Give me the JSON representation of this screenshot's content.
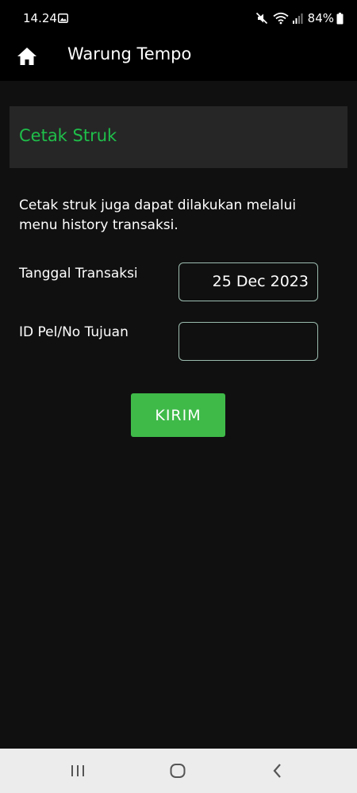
{
  "status_bar": {
    "time": "14.24",
    "battery": "84%"
  },
  "app_bar": {
    "title": "Warung Tempo"
  },
  "section": {
    "title": "Cetak Struk"
  },
  "info_text": "Cetak struk juga dapat dilakukan melalui menu history transaksi.",
  "form": {
    "date_label": "Tanggal Transaksi",
    "date_value": "25 Dec 2023",
    "id_label": "ID Pel/No Tujuan",
    "id_value": "",
    "submit_label": "KIRIM"
  },
  "colors": {
    "accent_green": "#1fbf4a",
    "button_green": "#3fba49",
    "background": "#101010",
    "header_panel": "#262626"
  },
  "icons": {
    "home": "home-icon",
    "gallery": "gallery-icon",
    "mute": "mute-icon",
    "wifi": "wifi-icon",
    "signal": "signal-icon",
    "battery": "battery-icon",
    "recents": "recents-icon",
    "nav_home": "nav-home-icon",
    "back": "back-icon"
  }
}
